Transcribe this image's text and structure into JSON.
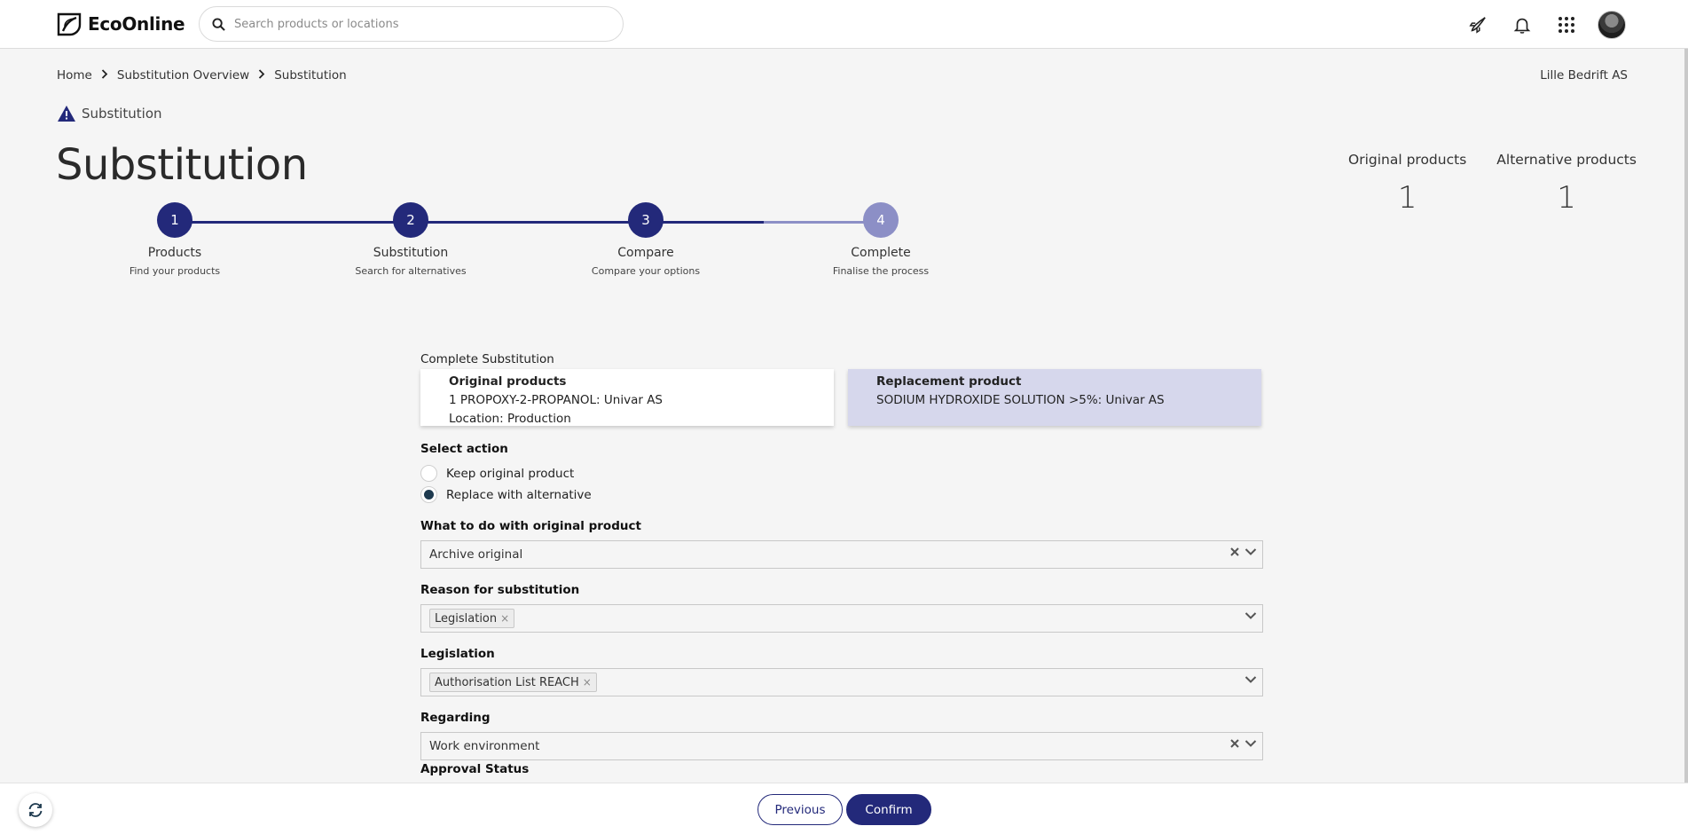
{
  "header": {
    "logo_text": "EcoOnline",
    "search_placeholder": "Search products or locations"
  },
  "breadcrumb": {
    "items": [
      "Home",
      "Substitution Overview",
      "Substitution"
    ]
  },
  "company": "Lille Bedrift AS",
  "subheader": "Substitution",
  "page_title": "Substitution",
  "counts": {
    "original_label": "Original products",
    "original_value": "1",
    "alternative_label": "Alternative products",
    "alternative_value": "1"
  },
  "stepper": {
    "steps": [
      {
        "number": "1",
        "title": "Products",
        "subtitle": "Find your products",
        "active": true
      },
      {
        "number": "2",
        "title": "Substitution",
        "subtitle": "Search for alternatives",
        "active": true
      },
      {
        "number": "3",
        "title": "Compare",
        "subtitle": "Compare your options",
        "active": true
      },
      {
        "number": "4",
        "title": "Complete",
        "subtitle": "Finalise the process",
        "active": false
      }
    ]
  },
  "form": {
    "section_title": "Complete Substitution",
    "original_card": {
      "title": "Original products",
      "product": "1 PROPOXY-2-PROPANOL: Univar AS",
      "location": "Location: Production"
    },
    "replacement_card": {
      "title": "Replacement product",
      "product": "SODIUM HYDROXIDE SOLUTION >5%: Univar AS"
    },
    "select_action_label": "Select action",
    "action_options": [
      {
        "label": "Keep original product",
        "checked": false
      },
      {
        "label": "Replace with alternative",
        "checked": true
      }
    ],
    "original_product_label": "What to do with original product",
    "original_product_value": "Archive original",
    "reason_label": "Reason for substitution",
    "reason_chip": "Legislation",
    "legislation_label": "Legislation",
    "legislation_chip": "Authorisation List REACH",
    "regarding_label": "Regarding",
    "regarding_value": "Work environment",
    "approval_label": "Approval Status"
  },
  "footer": {
    "previous_label": "Previous",
    "confirm_label": "Confirm"
  },
  "colors": {
    "primary": "#23297a",
    "primary_light": "#8c8fc6",
    "replacement_bg": "#d6d7ec"
  }
}
